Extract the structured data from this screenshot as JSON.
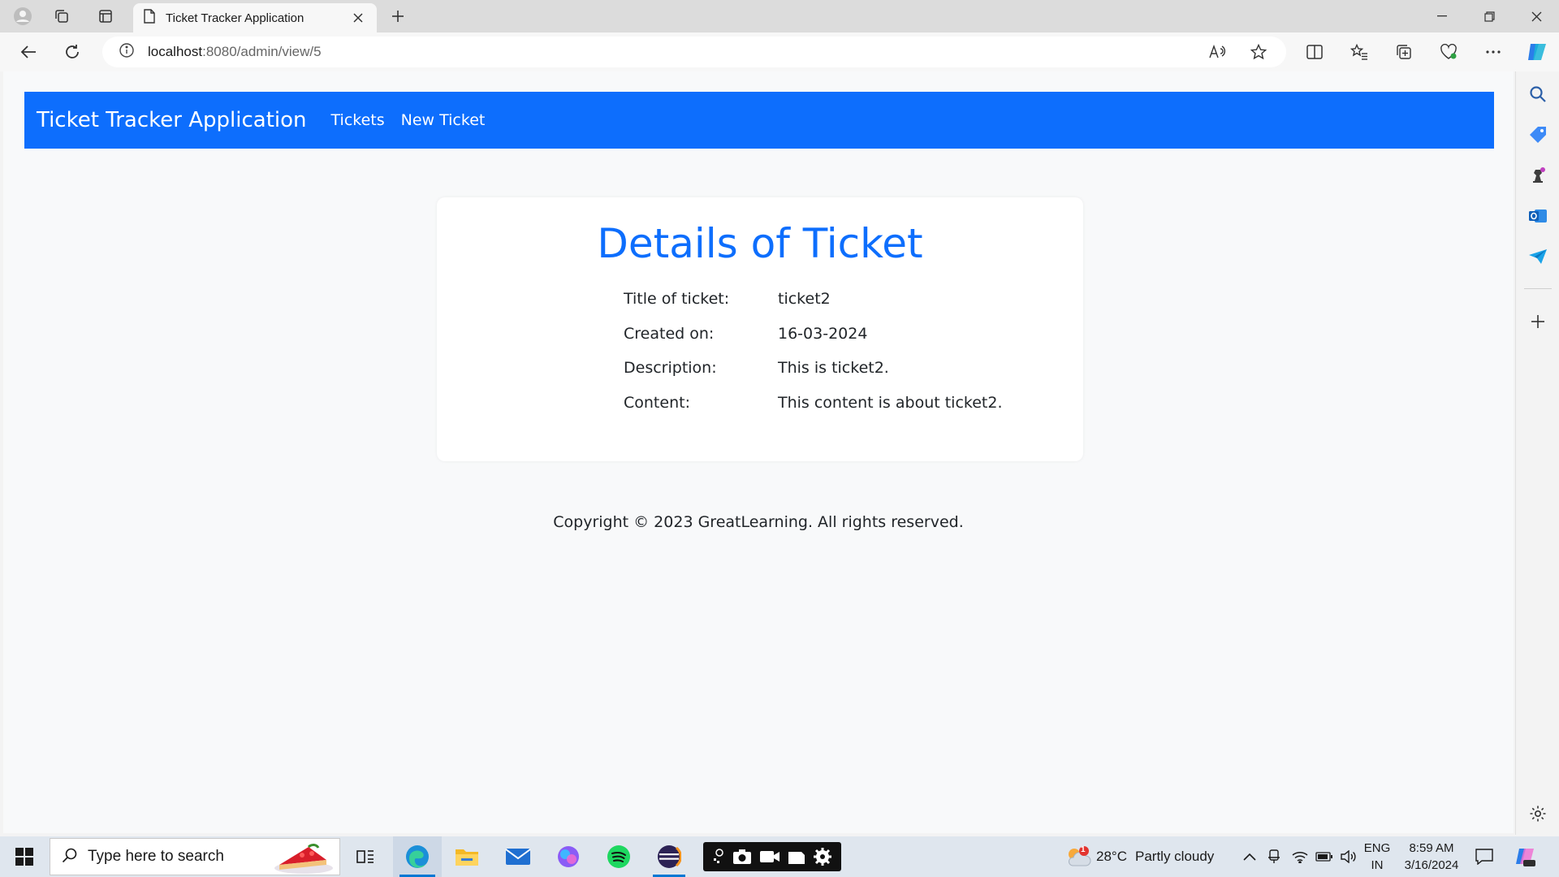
{
  "browser": {
    "tab_title": "Ticket Tracker Application",
    "url_host": "localhost",
    "url_path": ":8080/admin/view/5"
  },
  "app": {
    "brand": "Ticket Tracker Application",
    "nav": [
      {
        "label": "Tickets"
      },
      {
        "label": "New Ticket"
      }
    ],
    "accent_color": "#0d6efd"
  },
  "details": {
    "heading": "Details of Ticket",
    "rows": [
      {
        "label": "Title of ticket:",
        "value": "ticket2"
      },
      {
        "label": "Created on:",
        "value": "16-03-2024"
      },
      {
        "label": "Description:",
        "value": "This is ticket2."
      },
      {
        "label": "Content:",
        "value": "This content is about ticket2."
      }
    ]
  },
  "footer": {
    "text": "Copyright © 2023 GreatLearning. All rights reserved."
  },
  "taskbar": {
    "search_placeholder": "Type here to search",
    "weather_temp": "28°C",
    "weather_text": "Partly cloudy",
    "weather_badge": "1",
    "lang_line1": "ENG",
    "lang_line2": "IN",
    "time": "8:59 AM",
    "date": "3/16/2024"
  }
}
